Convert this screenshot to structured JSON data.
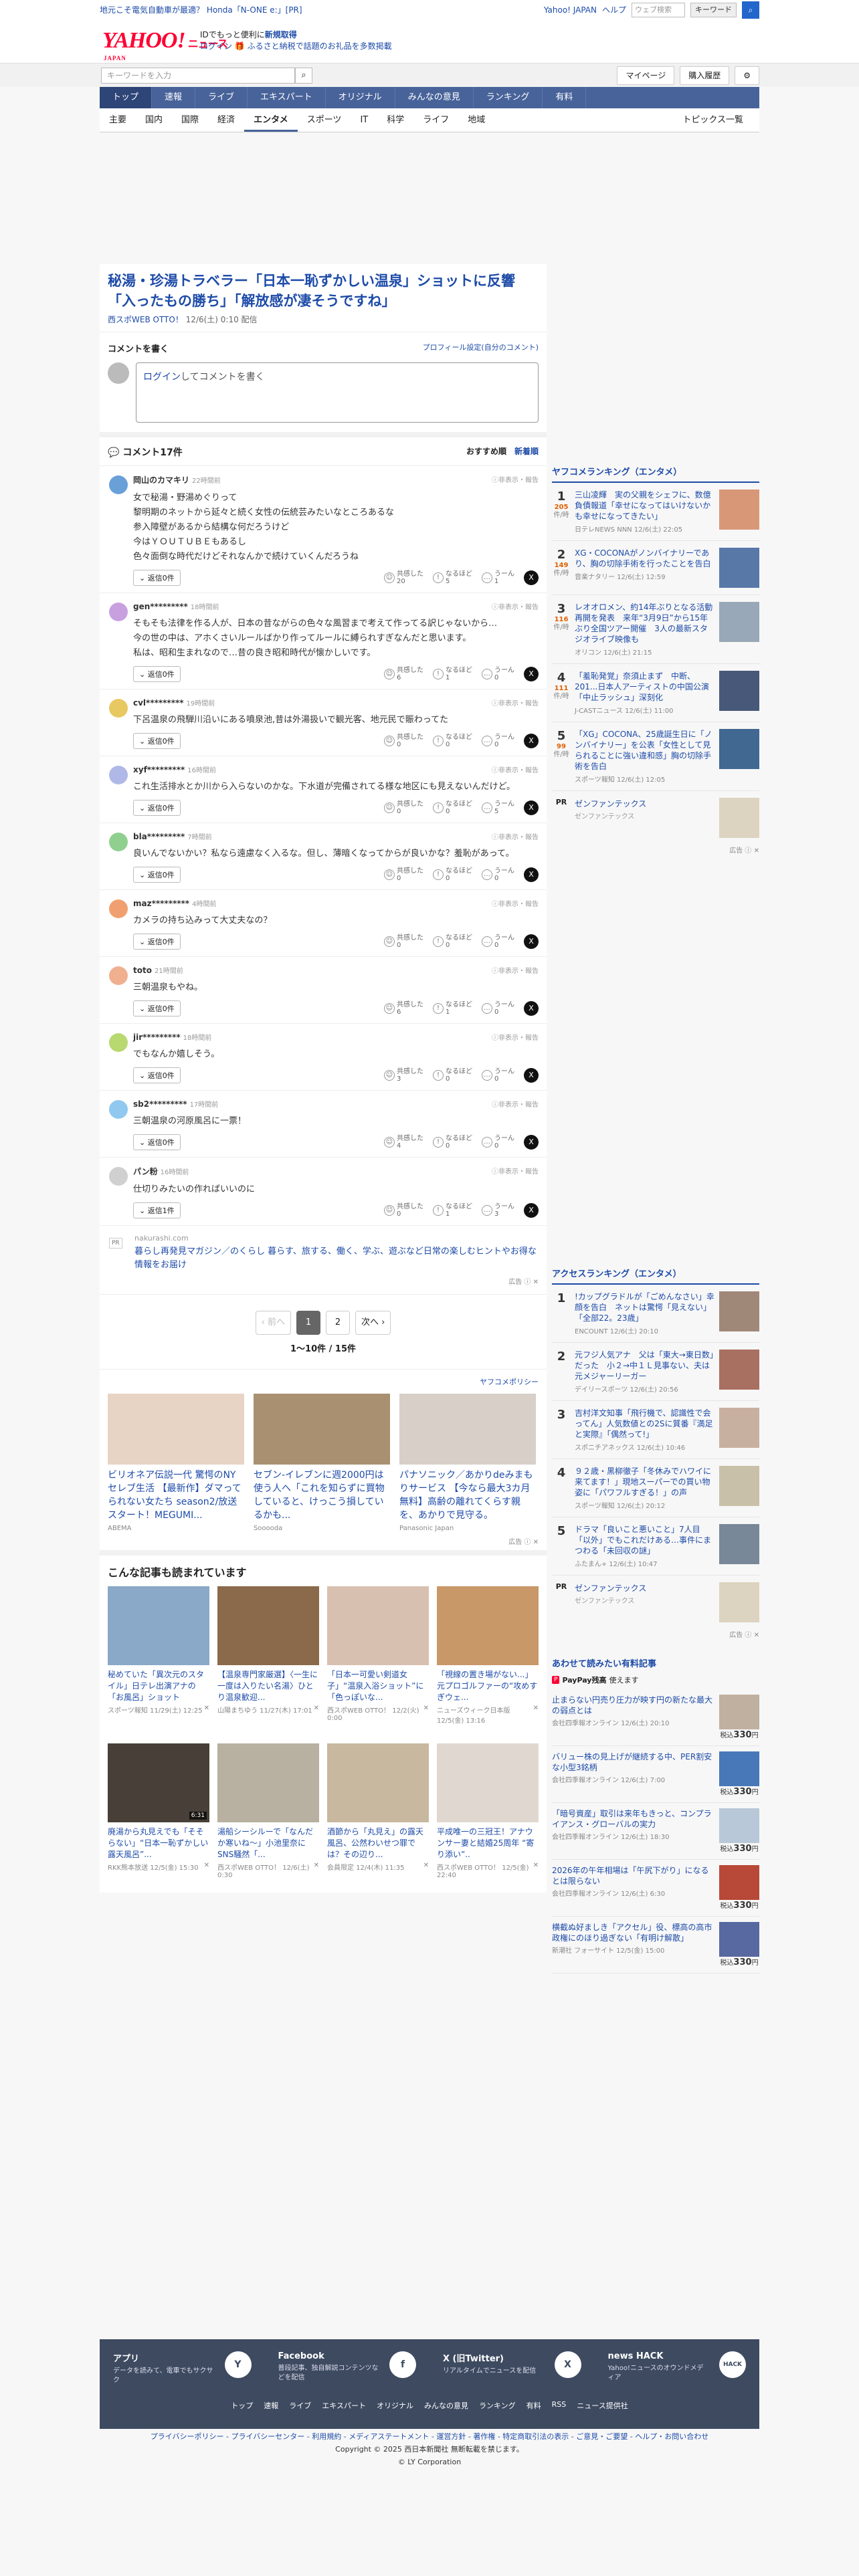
{
  "promo": {
    "ad_text": "地元こそ電気自動車が最適？ Honda「N-ONE e:」[PR]",
    "util": [
      "Yahoo! JAPAN",
      "ヘルプ"
    ],
    "search_placeholder": "ウェブ検索",
    "search_btn": "キーワード"
  },
  "logo": {
    "text": "YAHOO!",
    "sub": "JAPAN",
    "news": "ニュース"
  },
  "login_hint": {
    "line1_pre": "IDでもっと便利に",
    "line1_link": "新規取得",
    "login": "ログイン",
    "line2": "ふるさと納税で話題のお礼品を多数掲載"
  },
  "toolbar": {
    "keyword_placeholder": "キーワードを入力",
    "mypage": "マイページ",
    "purchase": "購入履歴"
  },
  "global_nav": [
    "トップ",
    "速報",
    "ライブ",
    "エキスパート",
    "オリジナル",
    "みんなの意見",
    "ランキング",
    "有料"
  ],
  "sub_nav": [
    "主要",
    "国内",
    "国際",
    "経済",
    "エンタメ",
    "スポーツ",
    "IT",
    "科学",
    "ライフ",
    "地域"
  ],
  "sub_nav_topics": "トピックス一覧",
  "article": {
    "title": "秘湯・珍湯トラベラー「日本一恥ずかしい温泉」ショットに反響「入ったもの勝ち」「解放感が凄そうですね」",
    "source": "西スポWEB OTTO！",
    "date": "12/6(土) 0:10 配信"
  },
  "comment_write": {
    "title": "コメントを書く",
    "profile_link": "プロフィール設定(自分のコメント)",
    "placeholder_link": "ログイン",
    "placeholder_rest": "してコメントを書く"
  },
  "comment_list": {
    "title": "コメント17件",
    "sort_recommended": "おすすめ順",
    "sort_new": "新着順",
    "report": "非表示・報告",
    "reply_prefix": "返信",
    "react_agree": "共感した",
    "react_ok": "なるほど",
    "react_hmm": "うーん"
  },
  "comments": [
    {
      "name": "岡山のカマキリ",
      "time": "22時間前",
      "avatar_color": "#6aa0d8",
      "body": "女で秘湯・野湯めぐりって\n黎明期のネットから延々と続く女性の伝統芸みたいなところあるな\n参入障壁があるから結構な何だろうけど\n今はＹＯＵＴＵＢＥもあるし\n色々面倒な時代だけどそれなんかで続けていくんだろうね",
      "replies": "0",
      "agree": "20",
      "ok": "5",
      "hmm": "1"
    },
    {
      "name": "gen*********",
      "time": "18時間前",
      "avatar_color": "#c8a0e0",
      "body": "そもそも法律を作る人が、日本の昔ながらの色々な風習まで考えて作ってる訳じゃないから…　　　　　　　　今の世の中は、アホくさいルールばかり作ってルールに縛られすぎなんだと思います。\n私は、昭和生まれなので…昔の良き昭和時代が懐かしいです。",
      "replies": "0",
      "agree": "6",
      "ok": "1",
      "hmm": "0"
    },
    {
      "name": "cvl*********",
      "time": "19時間前",
      "avatar_color": "#e8c860",
      "body": "下呂温泉の飛騨川沿いにある噴泉池,昔は外湯扱いで観光客、地元民で賑わってた",
      "replies": "0",
      "agree": "0",
      "ok": "0",
      "hmm": "0"
    },
    {
      "name": "xyf*********",
      "time": "16時間前",
      "avatar_color": "#b0b8e8",
      "body": "これ生活排水とか川から入らないのかな。下水道が完備されてる様な地区にも見えないんだけど。",
      "replies": "0",
      "agree": "0",
      "ok": "0",
      "hmm": "5"
    },
    {
      "name": "bla*********",
      "time": "7時間前",
      "avatar_color": "#8fd08f",
      "body": "良いんでないかい？私なら遠慮なく入るな。但し、薄暗くなってからが良いかな？羞恥があって。",
      "replies": "0",
      "agree": "0",
      "ok": "0",
      "hmm": "0"
    },
    {
      "name": "maz*********",
      "time": "4時間前",
      "avatar_color": "#f0a070",
      "body": "カメラの持ち込みって大丈夫なの？",
      "replies": "0",
      "agree": "0",
      "ok": "0",
      "hmm": "0"
    },
    {
      "name": "toto",
      "time": "21時間前",
      "avatar_color": "#f0b090",
      "body": "三朝温泉もやね。",
      "replies": "0",
      "agree": "6",
      "ok": "1",
      "hmm": "0"
    },
    {
      "name": "jir*********",
      "time": "18時間前",
      "avatar_color": "#b8d870",
      "body": "でもなんか嬉しそう。",
      "replies": "0",
      "agree": "3",
      "ok": "0",
      "hmm": "0"
    },
    {
      "name": "sb2*********",
      "time": "17時間前",
      "avatar_color": "#90c8f0",
      "body": "三朝温泉の河原風呂に一票！",
      "replies": "0",
      "agree": "4",
      "ok": "0",
      "hmm": "0"
    },
    {
      "name": "パン粉",
      "time": "16時間前",
      "avatar_color": "#d0d0d0",
      "body": "仕切りみたいの作ればいいのに",
      "replies": "1",
      "agree": "0",
      "ok": "1",
      "hmm": "3"
    }
  ],
  "inline_ad": {
    "domain": "nakurashi.com",
    "text": "暮らし再発見マガジン／のくらし 暮らす、旅する、働く、学ぶ、遊ぶなど日常の楽しむヒントやお得な情報をお届け",
    "tag": "広告"
  },
  "pager": {
    "prev": "前へ",
    "next": "次へ",
    "pages": [
      "1",
      "2"
    ],
    "count": "1〜10件 / 15件"
  },
  "policy": "ヤフコメポリシー",
  "recs": [
    {
      "title": "ビリオネア伝説一代 驚愕のNYセレブ生活 【最新作】ダマってられない女たち season2/放送スタート！MEGUMI...",
      "source": "ABEMA",
      "color": "#e8d4c4"
    },
    {
      "title": "セブン-イレブンに週2000円は使う人へ「これを知らずに買物していると、けっこう損しているかも...",
      "source": "Sooooda",
      "color": "#a89070"
    },
    {
      "title": "パナソニック／あかりdeみまもりサービス 【今なら最大3カ月無料】高齢の離れてくらす親を、あかりで見守る。",
      "source": "Panasonic Japan",
      "color": "#d8d0c8"
    }
  ],
  "ad_tag": "広告",
  "also_read_title": "こんな記事も読まれています",
  "also_read": [
    {
      "title": "秘めていた「異次元のスタイル」日テレ出演アナの「お風呂」ショット",
      "meta": "スポーツ報知 11/29(土) 12:25",
      "color": "#8aa8c8"
    },
    {
      "title": "【温泉専門家厳選】〈一生に一度は入りたい名湯〉ひとり温泉歓迎...",
      "meta": "山陽まちゆう 11/27(木) 17:01",
      "color": "#8a6a4a"
    },
    {
      "title": "「日本一可愛い剣道女子」“温泉入浴ショット”に「色っぽいな...",
      "meta": "西スポWEB OTTO！ 12/2(火) 0:00",
      "color": "#d8c0b0"
    },
    {
      "title": "「視線の置き場がない...」元プロゴルファーの“攻めすぎウェ...",
      "meta": "ニューズウィーク日本版 12/5(金) 13:16",
      "color": "#c89868"
    },
    {
      "title": "廃湯から丸見えでも「そそらない」“日本一恥ずかしい露天風呂”...",
      "meta": "RKK熊本放送 12/5(金) 15:30",
      "color": "#484038",
      "dur": "6:31"
    },
    {
      "title": "湯船シーシルーで「なんだか寒いね〜」小池里奈にSNS騒然「...",
      "meta": "西スポWEB OTTO！ 12/6(土) 0:30",
      "color": "#b8b0a0"
    },
    {
      "title": "酒節から「丸見え」の露天風呂、公然わいせつ罪では？その辺り...",
      "meta": "会員限定 12/4(木) 11:35",
      "color": "#c8b8a0"
    },
    {
      "title": "平成唯一の三冠王！アナウンサー妻と結婚25周年 “寄り添い”..",
      "meta": "西スポWEB OTTO！ 12/5(金) 22:40",
      "color": "#e0d8d0"
    }
  ],
  "ranking_ent": {
    "title": "ヤフコメランキング（エンタメ）",
    "unit": "件/時",
    "items": [
      {
        "no": "1",
        "count": "205",
        "title": "三山凌輝　実の父親をシェフに、数億負債報道「幸せになってはいけないかも幸せになってきたい」",
        "meta": "日テレNEWS NNN 12/6(土) 22:05",
        "color": "#d89878"
      },
      {
        "no": "2",
        "count": "149",
        "title": "XG・COCONAがノンバイナリーであり、胸の切除手術を行ったことを告白",
        "meta": "音楽ナタリー 12/6(土) 12:59",
        "color": "#5878a8"
      },
      {
        "no": "3",
        "count": "116",
        "title": "レオオロメン、約14年ぶりとなる活動再開を発表　来年“3月9日”から15年ぶり全国ツアー開催　3人の最新スタジオライブ映像も",
        "meta": "オリコン 12/6(土) 21:15",
        "color": "#98a8b8"
      },
      {
        "no": "4",
        "count": "111",
        "title": "「羞恥発覚」奈須止まず　中断、201...日本人アーティストの中国公演「中止ラッシュ」深刻化",
        "meta": "J-CASTニュース 12/6(土) 11:00",
        "color": "#485878"
      },
      {
        "no": "5",
        "count": "99",
        "title": "「XG」COCONA、25歳誕生日に「ノンバイナリー」を公表「女性として見られることに強い違和感」胸の切除手術を告白",
        "meta": "スポーツ報知 12/6(土) 12:05",
        "color": "#406890"
      }
    ]
  },
  "side_ad1": {
    "label": "PR",
    "title": "ゼンファンテックス",
    "sub": "ゼンファンテックス",
    "tag": "広告"
  },
  "ranking_access": {
    "title": "アクセスランキング（エンタメ）",
    "items": [
      {
        "no": "1",
        "title": "!カップグラドルが「ごめんなさい」幸顔を告白　ネットは驚愕「見えない」「全部22。23歳」",
        "meta": "ENCOUNT 12/6(土) 20:10",
        "color": "#a08878"
      },
      {
        "no": "2",
        "title": "元フジ人気アナ　父は「東大→東日数」だった　小２→中１Ｌ見事ない、夫は元メジャーリーガー",
        "meta": "デイリースポーツ 12/6(土) 20:56",
        "color": "#a87060"
      },
      {
        "no": "3",
        "title": "吉村洋文知事「飛行機で、認識性で会ってん」人気数値との2Sに質番『満足と実際』「偶然って!」",
        "meta": "スポニチアネックス 12/6(土) 10:46",
        "color": "#c8b0a0"
      },
      {
        "no": "4",
        "title": "９２歳・黒柳徹子「冬休みでハワイに来てます！」現地スーパーでの買い物姿に「パワフルすぎる！」の声",
        "meta": "スポーツ報知 12/6(土) 20:12",
        "color": "#c8c0a8"
      },
      {
        "no": "5",
        "title": "ドラマ「良いこと悪いこと」7人目「以外」でもこれだけある…事件にまつわる「未回収の謎」",
        "meta": "ふたまん+ 12/6(土) 10:47",
        "color": "#788898"
      }
    ]
  },
  "side_ad2": {
    "label": "PR",
    "title": "ゼンファンテックス",
    "sub": "ゼンファンテックス",
    "tag": "広告"
  },
  "paid": {
    "title": "あわせて読みたい有料記事",
    "paypay": "PayPay残高",
    "paypay_rest": "使えます",
    "items": [
      {
        "title": "止まらない円売り圧力が映す円の新たな最大の弱点とは",
        "meta": "会社四季報オンライン 12/6(土) 20:10",
        "price": "330",
        "color": "#c0b0a0"
      },
      {
        "title": "バリュー株の見上げが継続する中、PER割安な小型3銘柄",
        "meta": "会社四季報オンライン 12/6(土) 7:00",
        "price": "330",
        "color": "#4878b8"
      },
      {
        "title": "「暗号資産」取引は来年もきっと、コンプライアンス・グローバルの実力",
        "meta": "会社四季報オンライン 12/6(土) 18:30",
        "price": "330",
        "color": "#b8c8d8"
      },
      {
        "title": "2026年の午年相場は「午尻下がり」になるとは限らない",
        "meta": "会社四季報オンライン 12/6(土) 6:30",
        "price": "330",
        "color": "#b84838"
      },
      {
        "title": "横截ぬ好ましき「アクセル」役、標高の高市政権にのほり過ぎない「有明け解散」",
        "meta": "新潮社 フォーサイト 12/5(金) 15:00",
        "price": "330",
        "color": "#5868a0"
      }
    ],
    "price_prefix": "税込",
    "price_suffix": "円"
  },
  "footer": {
    "apps": [
      {
        "name": "アプリ",
        "desc": "データを読みて、電車でもサクサク",
        "icon": "Y"
      },
      {
        "name": "Facebook",
        "desc": "普段記事、独自解説コンテンツなどを配信",
        "icon": "f"
      },
      {
        "name": "X (旧Twitter)",
        "desc": "リアルタイムでニュースを配信",
        "icon": "X"
      },
      {
        "name": "news HACK",
        "desc": "Yahoo!ニュースのオウンドメディア",
        "icon": "HACK"
      }
    ],
    "links": [
      "トップ",
      "速報",
      "ライブ",
      "エキスパート",
      "オリジナル",
      "みんなの意見",
      "ランキング",
      "有料",
      "RSS",
      "ニュース提供社"
    ]
  },
  "legal": {
    "line1": "プライバシーポリシー - プライバシーセンター - 利用規約 - メディアステートメント - 運営方針 - 著作権 - 特定商取引法の表示 - ご意見・ご要望 - ヘルプ・お問い合わせ",
    "line2": "Copyright © 2025 西日本新聞社 無断転載を禁じます。",
    "line3": "© LY Corporation"
  },
  "colors": {
    "brand": "#ff0033",
    "link": "#1d4ba8",
    "nav": "#48639a"
  }
}
